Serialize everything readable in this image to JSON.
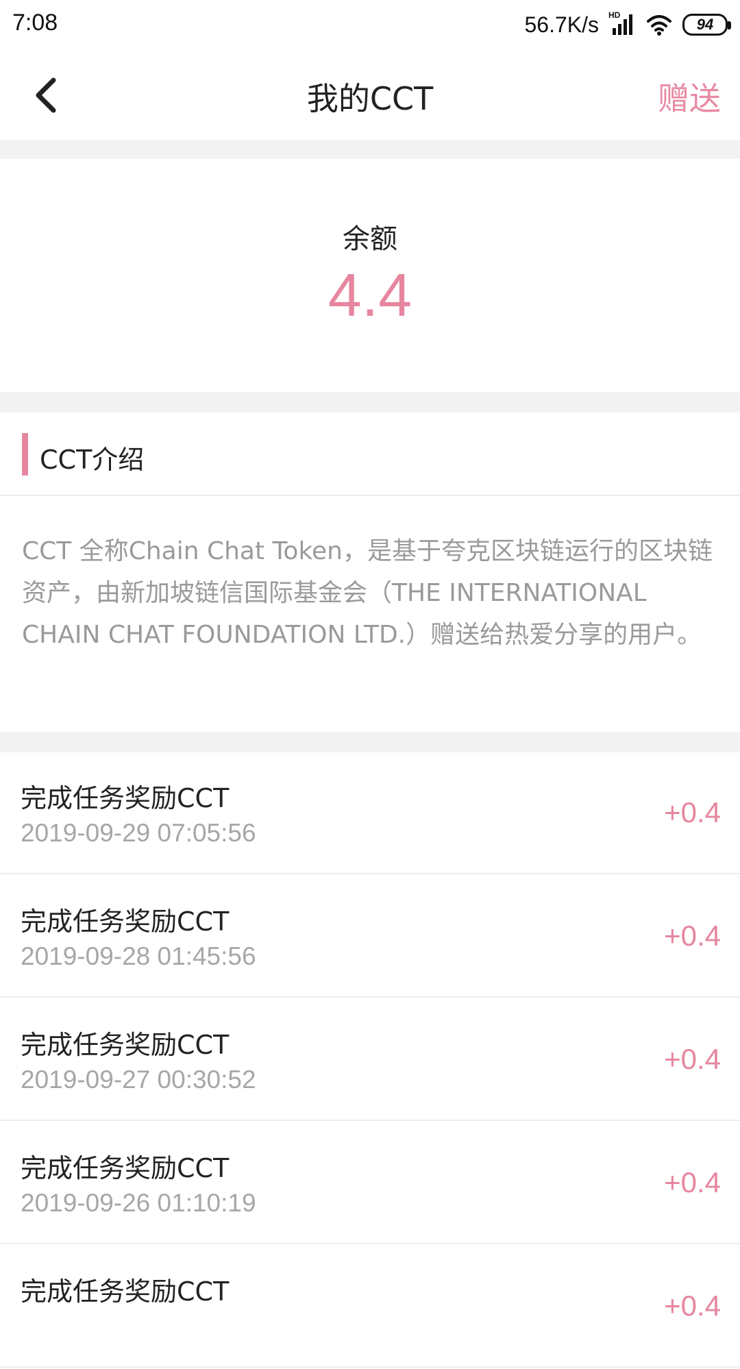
{
  "status_bar": {
    "time": "7:08",
    "net_speed": "56.7K/s",
    "signal_badge": "HD",
    "battery": "94"
  },
  "nav": {
    "title": "我的CCT",
    "action_label": "赠送"
  },
  "balance": {
    "label": "余额",
    "value": "4.4"
  },
  "intro": {
    "title": "CCT介绍",
    "text": "CCT 全称Chain Chat Token，是基于夸克区块链运行的区块链资产，由新加坡链信国际基金会（THE INTERNATIONAL CHAIN CHAT FOUNDATION LTD.）赠送给热爱分享的用户。"
  },
  "transactions": [
    {
      "title": "完成任务奖励CCT",
      "time": "2019-09-29 07:05:56",
      "amount": "+0.4"
    },
    {
      "title": "完成任务奖励CCT",
      "time": "2019-09-28 01:45:56",
      "amount": "+0.4"
    },
    {
      "title": "完成任务奖励CCT",
      "time": "2019-09-27 00:30:52",
      "amount": "+0.4"
    },
    {
      "title": "完成任务奖励CCT",
      "time": "2019-09-26 01:10:19",
      "amount": "+0.4"
    },
    {
      "title": "完成任务奖励CCT",
      "time": "",
      "amount": "+0.4"
    }
  ],
  "colors": {
    "accent": "#e6869f",
    "muted_text": "#9a9a9a",
    "divider": "#f3f3f3"
  },
  "icons": {
    "back": "chevron-left-icon",
    "signal": "signal-icon",
    "wifi": "wifi-icon",
    "battery": "battery-icon"
  }
}
